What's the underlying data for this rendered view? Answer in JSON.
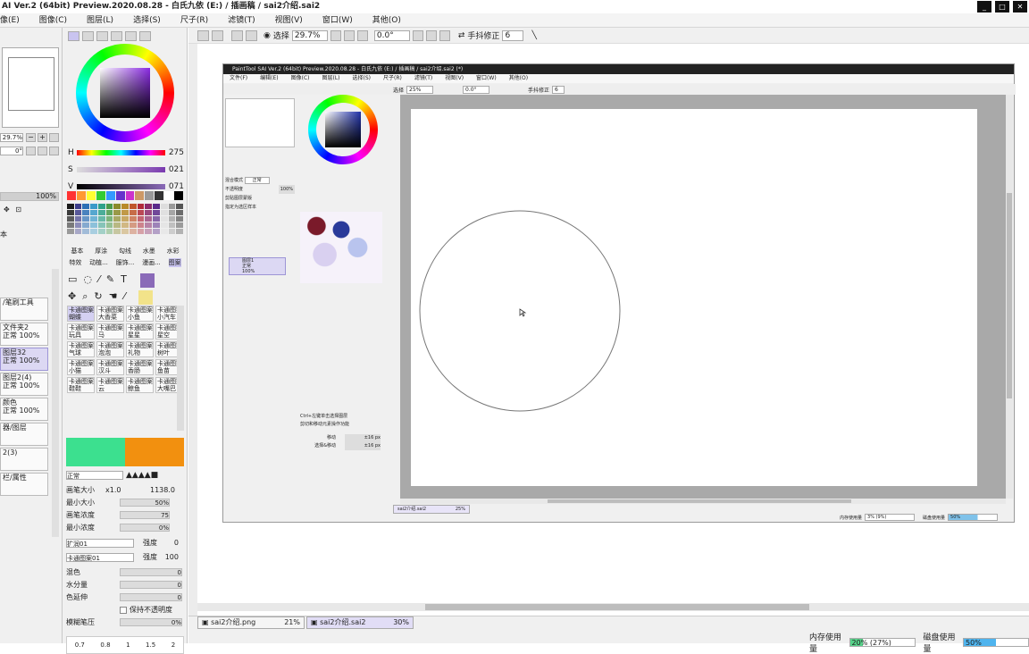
{
  "window": {
    "title": "AI Ver.2 (64bit) Preview.2020.08.28 - 白氏九依 (E:) / 插画稿 / sai2介绍.sai2",
    "controls": [
      "_",
      "□",
      "✕"
    ]
  },
  "menu": [
    "像(E)",
    "图像(C)",
    "图层(L)",
    "选择(S)",
    "尺子(R)",
    "滤镜(T)",
    "视图(V)",
    "窗口(W)",
    "其他(O)"
  ],
  "toolbar": {
    "select_label": "选择",
    "zoom": "29.7%",
    "angle": "0.0°",
    "stabilizer_label": "手抖修正",
    "stabilizer_value": "6"
  },
  "nav": {
    "zoom": "29.7%",
    "angle": "0°",
    "opacity": "100%"
  },
  "layers": [
    {
      "name": "/笔刷工具",
      "sub": "",
      "selected": false
    },
    {
      "name": "文件夹2",
      "sub": "正常 100%",
      "selected": false
    },
    {
      "name": "图层32",
      "sub": "正常 100%",
      "selected": true
    },
    {
      "name": "图层2(4)",
      "sub": "正常 100%",
      "selected": false
    },
    {
      "name": "颜色",
      "sub": "正常 100%",
      "selected": false
    },
    {
      "name": "器/图层",
      "sub": "",
      "selected": false
    },
    {
      "name": "2(3)",
      "sub": "",
      "selected": false
    },
    {
      "name": "栏/属性",
      "sub": "",
      "selected": false
    }
  ],
  "left_label_ben": "本",
  "color": {
    "h_label": "H",
    "h_value": "275",
    "s_label": "S",
    "s_value": "021",
    "v_label": "V",
    "v_value": "071"
  },
  "brush_tabs_row1": [
    "基本",
    "厚涂",
    "勾线",
    "水墨",
    "水彩"
  ],
  "brush_tabs_row2": [
    "特效",
    "动植...",
    "服饰...",
    "漫画...",
    "图案"
  ],
  "brushes": [
    "卡通图案蝴蝶",
    "卡通图案大香菜",
    "卡通图案小鱼",
    "卡通图案小汽车",
    "卡通图案玩具",
    "卡通图案马",
    "卡通图案星星",
    "卡通图案星空",
    "卡通图案气球",
    "卡通图案泡泡",
    "卡通图案礼物",
    "卡通图案树叶",
    "卡通图案小猫",
    "卡通图案汉斗",
    "卡通图案香肠",
    "卡通图案鱼苗",
    "卡通图案鞋鞋",
    "卡通图案云",
    "卡通图案鲸鱼",
    "卡通图案大嘴巴"
  ],
  "brush_settings": {
    "mode": "正常",
    "size_label": "画笔大小",
    "size_mult": "x1.0",
    "size_value": "1138.0",
    "min_size_label": "最小大小",
    "min_size_value": "50%",
    "density_label": "画笔浓度",
    "density_value": "75",
    "min_density_label": "最小浓度",
    "min_density_value": "0%",
    "texture1": "扩润01",
    "texture1_label": "强度",
    "texture1_value": "0",
    "texture2": "卡通图案01",
    "texture2_label": "强度",
    "texture2_value": "100",
    "blend_label": "混色",
    "blend_value": "0",
    "water_label": "水分量",
    "water_value": "0",
    "stretch_label": "色延伸",
    "stretch_value": "0",
    "keep_opacity_label": "保持不透明度",
    "blur_label": "模糊笔压",
    "blur_value": "0%",
    "presets": [
      "0.7",
      "0.8",
      "1",
      "1.5",
      "2"
    ]
  },
  "inner": {
    "title": "PaintTool SAI Ver.2 (64bit) Preview.2020.08.28 - 白氏九依 (E:) / 插画稿 / sai2介绍.sai2 (*)",
    "menu": [
      "文件(F)",
      "编辑(E)",
      "图像(C)",
      "图层(L)",
      "选择(S)",
      "尺子(R)",
      "滤镜(T)",
      "视图(V)",
      "窗口(W)",
      "其他(O)"
    ],
    "zoom": "25%",
    "angle": "0.0°",
    "stabilizer_label": "手抖修正",
    "stabilizer_value": "6",
    "layer_name": "图层1",
    "layer_mode": "正常",
    "layer_opacity": "100%",
    "blend_label": "混合模式",
    "blend_value": "正常",
    "opacity_label": "不透明度",
    "opacity_value": "100%",
    "clip_label": "剪贴图层蒙版",
    "select_source_label": "指定为选区样本",
    "tab_file": "sai2介绍.sai2",
    "tab_zoom": "25%",
    "mem_label": "内存使用量",
    "mem_value": "3% (9%)",
    "disk_label": "磁盘使用量",
    "disk_value": "50%",
    "options": [
      "Ctrl+左键单击选择图层",
      "剪切和移动元素操作功能"
    ],
    "move_label": "移动",
    "move_value": "±16 px",
    "select_move_label": "选择&移动",
    "select_move_value": "±16 px"
  },
  "status": {
    "tab1": "sai2介绍.png",
    "tab1_zoom": "21%",
    "tab2": "sai2介绍.sai2",
    "tab2_zoom": "30%",
    "mem_label": "内存使用量",
    "mem_value": "20% (27%)",
    "mem_fill": 0.2,
    "disk_label": "磁盘使用量",
    "disk_value": "50%",
    "disk_fill": 0.5
  },
  "palette_colors": [
    "#1a1a1a",
    "#3d3d8a",
    "#2d6fb5",
    "#3b9ac9",
    "#2fa18a",
    "#4a9a4a",
    "#8a8a2a",
    "#b88a2a",
    "#c0552a",
    "#b02a3a",
    "#8a2a6a",
    "#5a2a8a",
    "#dddddd",
    "#999999",
    "#555555"
  ],
  "swatch_row": [
    "#ff3333",
    "#ff9933",
    "#ffff33",
    "#33cc33",
    "#3399ff",
    "#6633cc",
    "#cc33cc",
    "#cc9966",
    "#999999",
    "#333333",
    "#ffffff",
    "#000000"
  ]
}
